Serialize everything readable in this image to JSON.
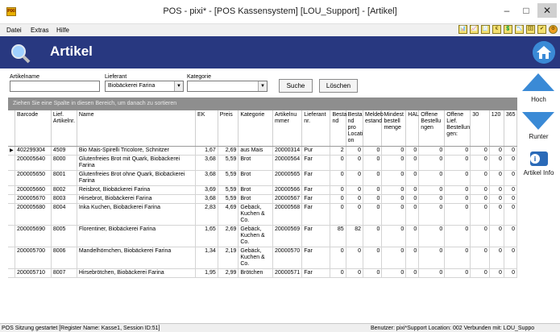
{
  "window": {
    "title": "POS - pixi* - [POS Kassensystem] [LOU_Support] - [Artikel]",
    "app_icon": "pixi-app-icon"
  },
  "menu": [
    "Datei",
    "Extras",
    "Hilfe"
  ],
  "toolbar_icons": [
    "📊",
    "📈",
    "🧾",
    "€",
    "💲",
    "📉",
    "🗄",
    "✔",
    "⚙"
  ],
  "header": {
    "title": "Artikel"
  },
  "filters": {
    "artikelname_label": "Artikelname",
    "artikelname_value": "",
    "lieferant_label": "Lieferant",
    "lieferant_value": "Biobäckerei Farina",
    "kategorie_label": "Kategorie",
    "kategorie_value": "",
    "search_button": "Suche",
    "clear_button": "Löschen"
  },
  "group_hint": "Ziehen Sie eine Spalte in diesen Bereich, um danach zu sortieren",
  "columns": [
    "Barcode",
    "Lief. Artikelnr.",
    "Name",
    "EK",
    "Preis",
    "Kategorie",
    "Artikelnu mmer",
    "Lieferant nr.",
    "Besta nd",
    "Besta nd pro Locati on",
    "Meldeb estand",
    "Mindest bestell menge",
    "HAL",
    "Offene Bestellu ngen",
    "Offene Lief. Bestellun gen:",
    "30",
    "120",
    "365"
  ],
  "rows": [
    [
      "402299304",
      "4509",
      "Bio Mais-Spirelli Tricolore, Schnitzer",
      "1,67",
      "2,69",
      "aus Mais",
      "20000314",
      "Pur",
      "2",
      "0",
      "0",
      "0",
      "0",
      "0",
      "0",
      "0",
      "0",
      "0"
    ],
    [
      "200005640",
      "8000",
      "Glutenfreies Brot mit Quark, Biobäckerei Farina",
      "3,68",
      "5,59",
      "Brot",
      "20000564",
      "Far",
      "0",
      "0",
      "0",
      "0",
      "0",
      "0",
      "0",
      "0",
      "0",
      "0"
    ],
    [
      "200005650",
      "8001",
      "Glutenfreies Brot ohne Quark, Biobäckerei Farina",
      "3,68",
      "5,59",
      "Brot",
      "20000565",
      "Far",
      "0",
      "0",
      "0",
      "0",
      "0",
      "0",
      "0",
      "0",
      "0",
      "0"
    ],
    [
      "200005660",
      "8002",
      "Reisbrot, Biobäckerei Farina",
      "3,69",
      "5,59",
      "Brot",
      "20000566",
      "Far",
      "0",
      "0",
      "0",
      "0",
      "0",
      "0",
      "0",
      "0",
      "0",
      "0"
    ],
    [
      "200005670",
      "8003",
      "Hirsebrot, Biobäckerei Farina",
      "3,68",
      "5,59",
      "Brot",
      "20000567",
      "Far",
      "0",
      "0",
      "0",
      "0",
      "0",
      "0",
      "0",
      "0",
      "0",
      "0"
    ],
    [
      "200005680",
      "8004",
      "Inka Kuchen, Biobäckerei Farina",
      "2,83",
      "4,69",
      "Gebäck, Kuchen & Co.",
      "20000568",
      "Far",
      "0",
      "0",
      "0",
      "0",
      "0",
      "0",
      "0",
      "0",
      "0",
      "0"
    ],
    [
      "200005690",
      "8005",
      "Florentiner, Biobäckerei Farina",
      "1,65",
      "2,69",
      "Gebäck, Kuchen & Co.",
      "20000569",
      "Far",
      "85",
      "82",
      "0",
      "0",
      "0",
      "0",
      "0",
      "0",
      "0",
      "0"
    ],
    [
      "200005700",
      "8006",
      "Mandelhörnchen, Biobäckerei Farina",
      "1,34",
      "2,19",
      "Gebäck, Kuchen & Co.",
      "20000570",
      "Far",
      "0",
      "0",
      "0",
      "0",
      "0",
      "0",
      "0",
      "0",
      "0",
      "0"
    ],
    [
      "200005710",
      "8007",
      "Hirsebrötchen, Biobäckerei Farina",
      "1,95",
      "2,99",
      "Brötchen",
      "20000571",
      "Far",
      "0",
      "0",
      "0",
      "0",
      "0",
      "0",
      "0",
      "0",
      "0",
      "0"
    ]
  ],
  "side_nav": {
    "up_label": "Hoch",
    "down_label": "Runter",
    "info_label": "Artikel Info"
  },
  "status": {
    "left": "POS Sitzung gestartet [Register Name: Kasse1, Session ID:51]",
    "right": "Benutzer: pixi*Support Location: 002 Verbunden mit: LOU_Suppo"
  }
}
